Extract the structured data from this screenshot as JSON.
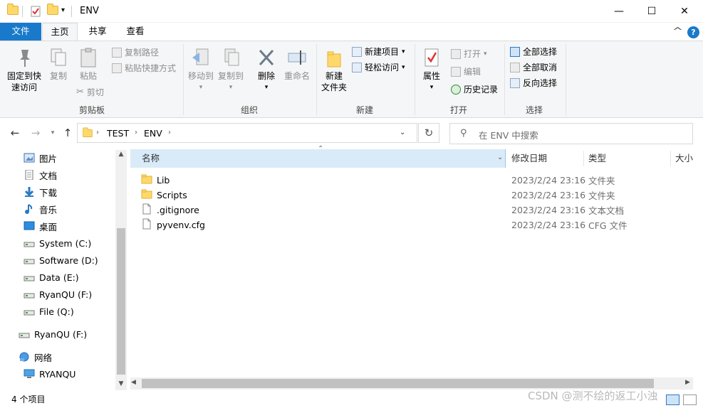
{
  "window": {
    "title": "ENV",
    "minimize": "—",
    "maximize": "☐",
    "close": "✕"
  },
  "ribbon": {
    "tabs": [
      "文件",
      "主页",
      "共享",
      "查看"
    ],
    "collapse": "^",
    "help": "?",
    "clipboard": {
      "pin_line1": "固定到快",
      "pin_line2": "速访问",
      "copy": "复制",
      "paste": "粘贴",
      "copy_path": "复制路径",
      "paste_shortcut": "粘贴快捷方式",
      "cut": "剪切",
      "label": "剪贴板"
    },
    "organize": {
      "move_to": "移动到",
      "copy_to": "复制到",
      "delete": "删除",
      "rename": "重命名",
      "label": "组织"
    },
    "new": {
      "new_folder_line1": "新建",
      "new_folder_line2": "文件夹",
      "new_item": "新建项目",
      "easy_access": "轻松访问",
      "label": "新建"
    },
    "open": {
      "properties": "属性",
      "open": "打开",
      "edit": "编辑",
      "history": "历史记录",
      "label": "打开"
    },
    "select": {
      "select_all": "全部选择",
      "select_none": "全部取消",
      "invert": "反向选择",
      "label": "选择"
    }
  },
  "address": {
    "crumbs": [
      "TEST",
      "ENV"
    ],
    "search_placeholder": "在 ENV 中搜索"
  },
  "nav": {
    "items": [
      {
        "label": "图片",
        "icon": "pictures-icon"
      },
      {
        "label": "文档",
        "icon": "documents-icon"
      },
      {
        "label": "下载",
        "icon": "downloads-icon"
      },
      {
        "label": "音乐",
        "icon": "music-icon"
      },
      {
        "label": "桌面",
        "icon": "desktop-icon"
      },
      {
        "label": "System (C:)",
        "icon": "drive-icon"
      },
      {
        "label": "Software (D:)",
        "icon": "drive-icon"
      },
      {
        "label": "Data (E:)",
        "icon": "drive-icon"
      },
      {
        "label": "RyanQU (F:)",
        "icon": "drive-icon"
      },
      {
        "label": "File (Q:)",
        "icon": "drive-icon"
      }
    ],
    "usb": "RyanQU (F:)",
    "network": "网络",
    "computer": "RYANQU"
  },
  "files": {
    "columns": [
      "名称",
      "修改日期",
      "类型",
      "大小"
    ],
    "rows": [
      {
        "name": "Lib",
        "date": "2023/2/24 23:16",
        "type": "文件夹",
        "kind": "folder"
      },
      {
        "name": "Scripts",
        "date": "2023/2/24 23:16",
        "type": "文件夹",
        "kind": "folder"
      },
      {
        "name": ".gitignore",
        "date": "2023/2/24 23:16",
        "type": "文本文档",
        "kind": "file"
      },
      {
        "name": "pyvenv.cfg",
        "date": "2023/2/24 23:16",
        "type": "CFG 文件",
        "kind": "file"
      }
    ]
  },
  "status": {
    "count": "4 个项目",
    "watermark": "CSDN @测不绘的返工小浊"
  }
}
